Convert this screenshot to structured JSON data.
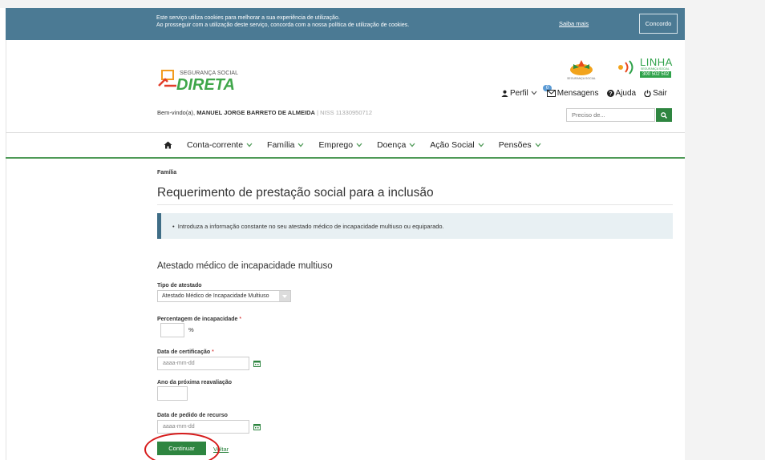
{
  "cookie_banner": {
    "line1": "Este serviço utiliza cookies para melhorar a sua experiência de utilização.",
    "line2": "Ao prosseguir com a utilização deste serviço, concorda com a nossa política de utilização de cookies.",
    "more_link": "Saiba mais",
    "accept_button": "Concordo"
  },
  "header": {
    "logo_small": "SEGURANÇA SOCIAL",
    "logo_big": "DIRETA",
    "welcome_prefix": "Bem-vindo(a), ",
    "user_name": "MANUEL JORGE BARRETO DE ALMEIDA",
    "niss": " | NISS 11330950712",
    "ss_logo_text": "SEGURANÇA SOCIAL",
    "linha_word": "LINHA",
    "linha_sub": "SEGURANÇA SOCIAL",
    "linha_number": "300 502 502",
    "user_nav": {
      "perfil": "Perfil",
      "messages_badge": "0",
      "mensagens": "Mensagens",
      "ajuda": "Ajuda",
      "sair": "Sair"
    },
    "search_placeholder": "Preciso de..."
  },
  "main_nav": {
    "items": [
      "Conta-corrente",
      "Família",
      "Emprego",
      "Doença",
      "Ação Social",
      "Pensões"
    ]
  },
  "content": {
    "breadcrumb": "Família",
    "page_title": "Requerimento de prestação social para a inclusão",
    "info_message": "Introduza a informação constante no seu atestado médico de incapacidade multiuso ou equiparado.",
    "section_title": "Atestado médico de incapacidade multiuso",
    "fields": {
      "tipo_label": "Tipo de atestado",
      "tipo_value": "Atestado Médico de Incapacidade Multiuso",
      "percent_label": "Percentagem de incapacidade",
      "percent_unit": "%",
      "cert_label": "Data de certificação",
      "cert_placeholder": "aaaa-mm-dd",
      "reaval_label": "Ano da próxima reavaliação",
      "recurso_label": "Data de pedido de recurso",
      "recurso_placeholder": "aaaa-mm-dd",
      "required_mark": "*"
    },
    "continue_button": "Continuar",
    "back_link": "Voltar"
  },
  "colors": {
    "banner": "#4b7a94",
    "brand_green": "#2e8540",
    "info_bg": "#e8f0f3",
    "annotation_red": "#d61a1a"
  }
}
